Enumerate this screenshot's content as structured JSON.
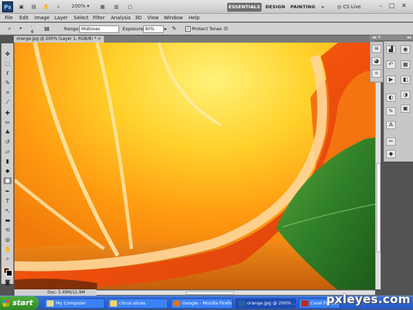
{
  "titlebar": {
    "logo": "Ps",
    "zoom": "200%",
    "workspaces": [
      "ESSENTIALS",
      "DESIGN",
      "PAINTING"
    ],
    "more_workspaces": "»",
    "cs_live": "CS Live",
    "minimize": "–",
    "restore": "□",
    "close": "✕"
  },
  "menu": [
    "File",
    "Edit",
    "Image",
    "Layer",
    "Select",
    "Filter",
    "Analysis",
    "3D",
    "View",
    "Window",
    "Help"
  ],
  "options": {
    "brush_size": "6",
    "range_label": "Range:",
    "range_value": "Midtones",
    "exposure_label": "Exposure:",
    "exposure_value": "80%",
    "protect_tones_label": "Protect Tones",
    "protect_tones_checked": "✓"
  },
  "document": {
    "tab_label": "orange.jpg @ 200% (Layer 1, RGB/8) *",
    "status_text": "Doc: 5.49M/11.9M"
  },
  "colors": {
    "foreground": "#5a2a0a",
    "background": "#000000"
  },
  "taskbar": {
    "start_label": "start",
    "tasks": [
      {
        "label": "My Computer"
      },
      {
        "label": "citrus slices"
      },
      {
        "label": "Google - Mozilla Firefox"
      },
      {
        "label": "orange.jpg @ 200% ..."
      },
      {
        "label": "Corel Painter"
      }
    ]
  },
  "watermark": "pxleyes.com"
}
